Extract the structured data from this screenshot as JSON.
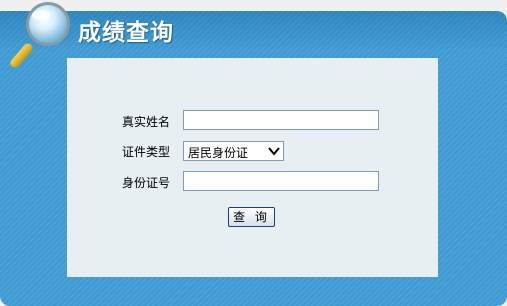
{
  "header": {
    "title": "成绩查询",
    "icon": "magnifier-icon"
  },
  "form": {
    "name_label": "真实姓名",
    "name_value": "",
    "id_type_label": "证件类型",
    "id_type_selected": "居民身份证",
    "id_number_label": "身份证号",
    "id_number_value": "",
    "query_button": "查 询"
  },
  "colors": {
    "panel": "#3f9bd2",
    "form_bg": "#e7eff3",
    "input_border": "#7f9db9",
    "button_border": "#1c3e7c"
  }
}
